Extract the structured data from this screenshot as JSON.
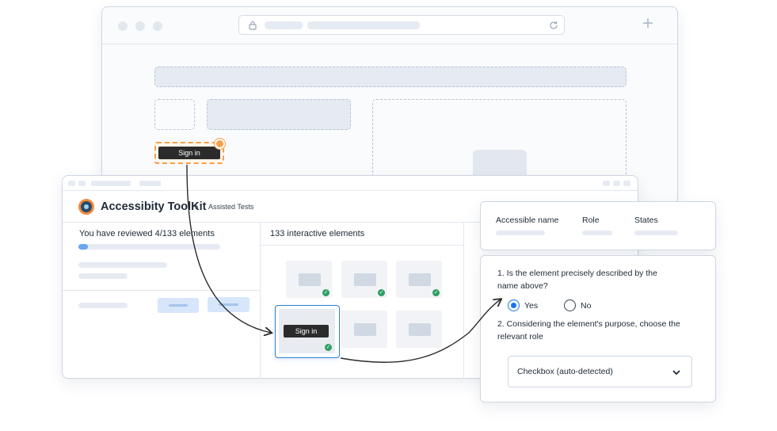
{
  "browser": {
    "new_tab_glyph": "+"
  },
  "page": {
    "sign_in_label": "Sign in"
  },
  "toolkit": {
    "app_name": "Accessibity ToolKit",
    "breadcrumb_sep": "›",
    "breadcrumb": "Assisted Tests",
    "progress_text": "You have reviewed 4/133 elements",
    "progress": {
      "reviewed": 4,
      "total": 133
    },
    "elements_header": "133 interactive elements",
    "selected_card_label": "Sign in"
  },
  "info_panel": {
    "headers": [
      "Accessible name",
      "Role",
      "States"
    ]
  },
  "question_panel": {
    "q1": "1. Is the element precisely described by the name above?",
    "options": [
      "Yes",
      "No"
    ],
    "selected_option": "Yes",
    "q2": "2. Considering the element's purpose, choose the relevant role",
    "role_select_value": "Checkbox (auto-detected)"
  },
  "colors": {
    "accent": "#1a73e8",
    "highlight_orange": "#f5a04a",
    "check_green": "#2e9e63",
    "selected_border": "#2f80d6"
  }
}
